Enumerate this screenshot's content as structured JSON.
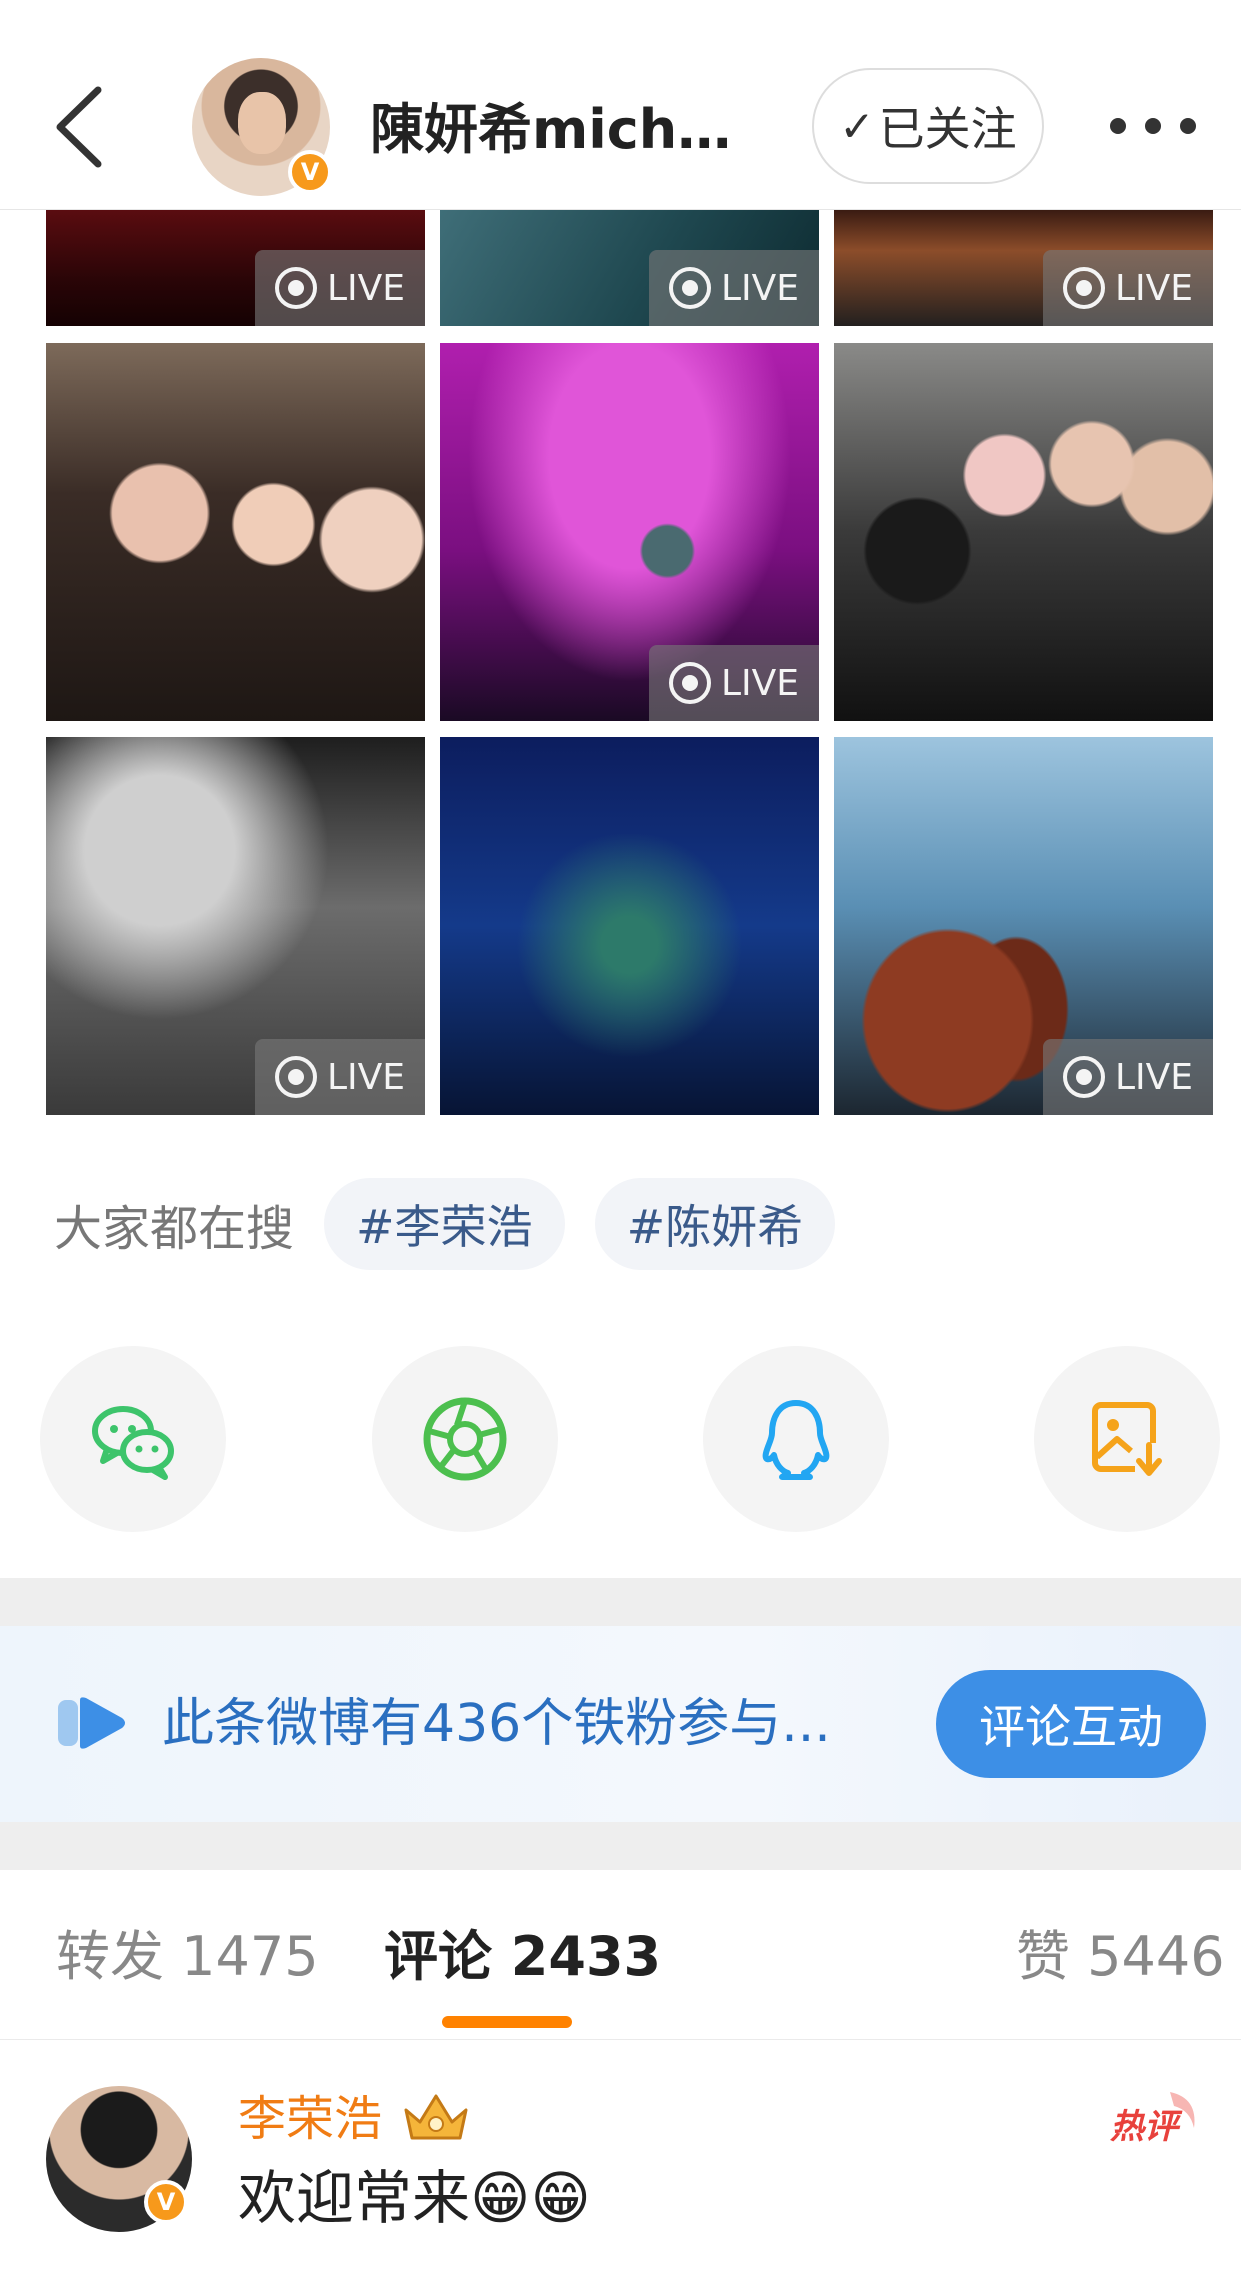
{
  "header": {
    "username": "陳妍希michel...",
    "follow_label": "已关注",
    "follow_check": "✓",
    "verified_badge": "V"
  },
  "photos": [
    {
      "live": true,
      "live_label": "LIVE"
    },
    {
      "live": true,
      "live_label": "LIVE"
    },
    {
      "live": true,
      "live_label": "LIVE"
    },
    {
      "live": false
    },
    {
      "live": true,
      "live_label": "LIVE"
    },
    {
      "live": false
    },
    {
      "live": true,
      "live_label": "LIVE"
    },
    {
      "live": false
    },
    {
      "live": true,
      "live_label": "LIVE"
    }
  ],
  "search": {
    "label": "大家都在搜",
    "tags": [
      "#李荣浩",
      "#陈妍希"
    ]
  },
  "share": {
    "icons": [
      "wechat-icon",
      "moments-icon",
      "qq-icon",
      "save-image-icon"
    ]
  },
  "fans_banner": {
    "text": "此条微博有436个铁粉参与...",
    "button_label": "评论互动"
  },
  "tabs": {
    "repost": "转发 1475",
    "comments": "评论 2433",
    "likes": "赞 5446"
  },
  "comment": {
    "author": "李荣浩",
    "text": "欢迎常来😁😁",
    "verified_badge": "V",
    "hot_label": "热评"
  },
  "colors": {
    "accent_orange": "#ff8200",
    "link_blue": "#2a6fc0",
    "button_blue": "#3d8fe6",
    "verified_orange": "#f7991b",
    "wechat_green": "#3dc46b",
    "qq_blue": "#22a6f2",
    "save_orange": "#f5a31a",
    "hot_red": "#e8413c"
  }
}
